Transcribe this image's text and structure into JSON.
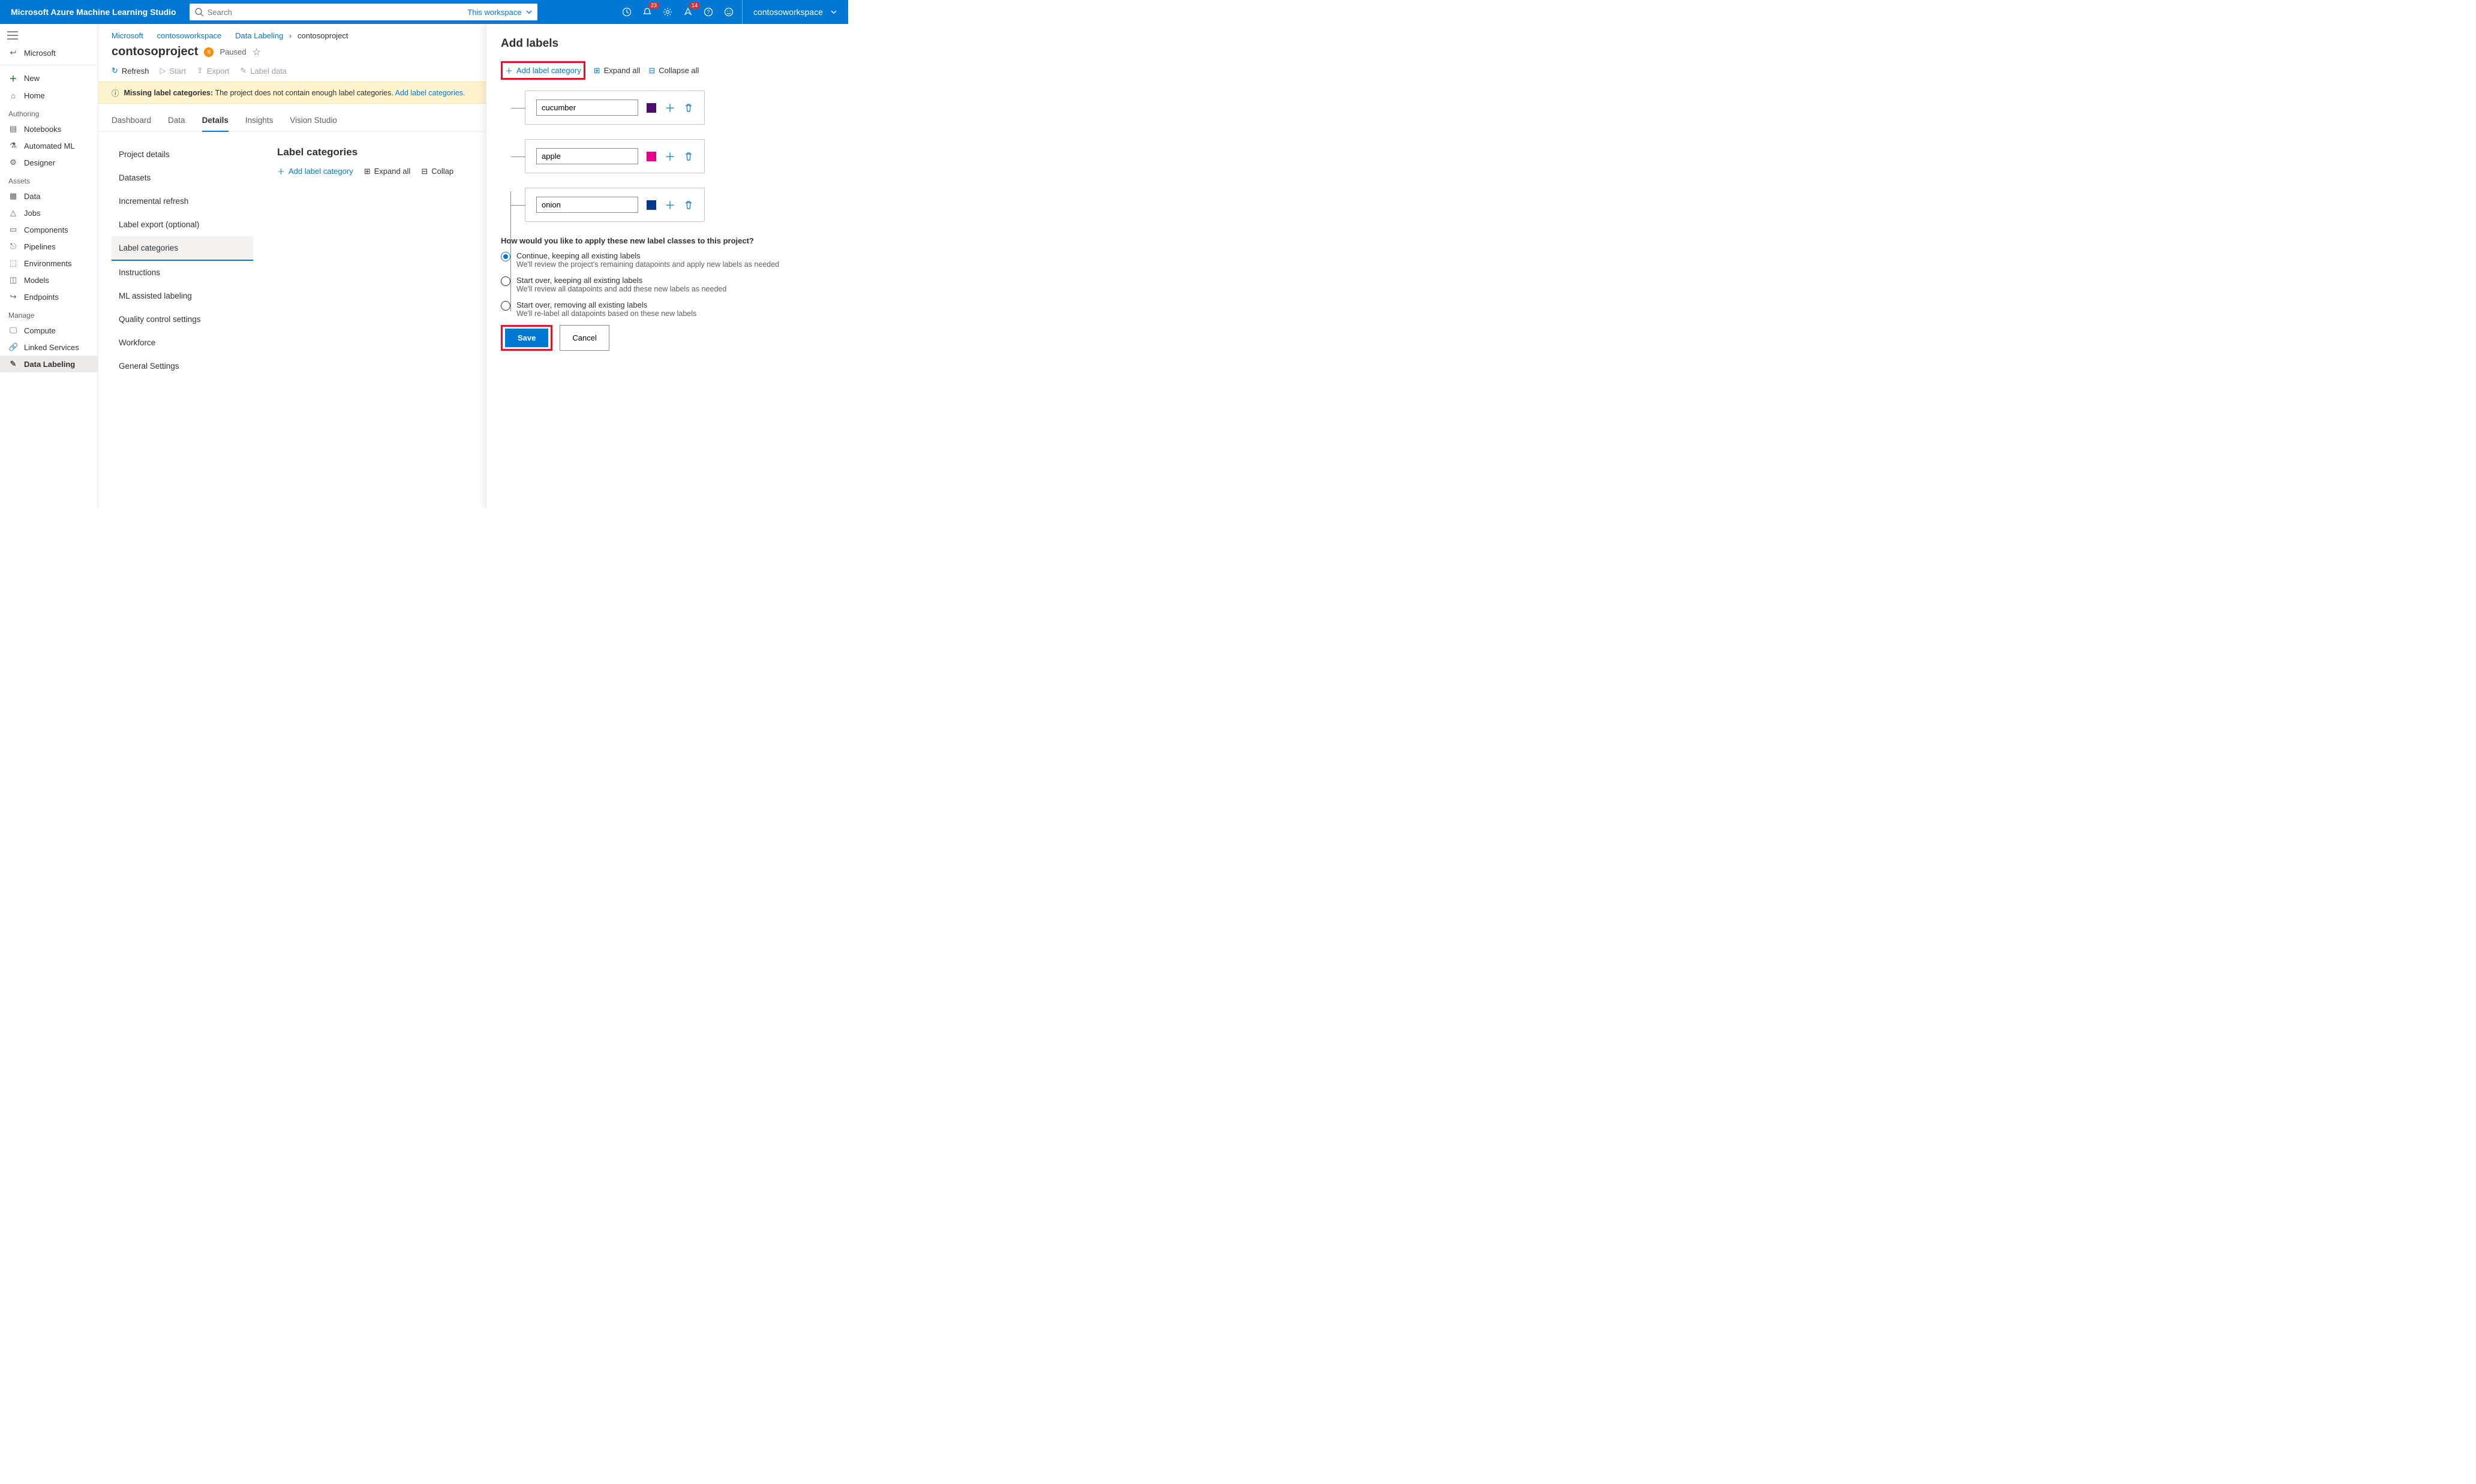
{
  "topbar": {
    "product": "Microsoft Azure Machine Learning Studio",
    "search_placeholder": "Search",
    "scope": "This workspace",
    "bell_badge": "23",
    "arrow_badge": "14",
    "workspace": "contosoworkspace"
  },
  "nav": {
    "back": "Microsoft",
    "items_top": [
      {
        "key": "new",
        "label": "New"
      },
      {
        "key": "home",
        "label": "Home"
      }
    ],
    "section_authoring": "Authoring",
    "items_authoring": [
      {
        "key": "notebooks",
        "label": "Notebooks"
      },
      {
        "key": "automl",
        "label": "Automated ML"
      },
      {
        "key": "designer",
        "label": "Designer"
      }
    ],
    "section_assets": "Assets",
    "items_assets": [
      {
        "key": "data",
        "label": "Data"
      },
      {
        "key": "jobs",
        "label": "Jobs"
      },
      {
        "key": "components",
        "label": "Components"
      },
      {
        "key": "pipelines",
        "label": "Pipelines"
      },
      {
        "key": "environments",
        "label": "Environments"
      },
      {
        "key": "models",
        "label": "Models"
      },
      {
        "key": "endpoints",
        "label": "Endpoints"
      }
    ],
    "section_manage": "Manage",
    "items_manage": [
      {
        "key": "compute",
        "label": "Compute"
      },
      {
        "key": "linked",
        "label": "Linked Services"
      },
      {
        "key": "labeling",
        "label": "Data Labeling"
      }
    ]
  },
  "crumbs": {
    "microsoft": "Microsoft",
    "ws": "contosoworkspace",
    "dl": "Data Labeling",
    "proj": "contosoproject"
  },
  "header": {
    "title": "contosoproject",
    "status": "Paused"
  },
  "toolbar": {
    "refresh": "Refresh",
    "start": "Start",
    "export": "Export",
    "labeldata": "Label data"
  },
  "notice": {
    "lead": "Missing label categories:",
    "body": "The project does not contain enough label categories.",
    "link": "Add label categories."
  },
  "tabs": [
    "Dashboard",
    "Data",
    "Details",
    "Insights",
    "Vision Studio"
  ],
  "active_tab": "Details",
  "subnav": [
    "Project details",
    "Datasets",
    "Incremental refresh",
    "Label export (optional)",
    "Label categories",
    "Instructions",
    "ML assisted labeling",
    "Quality control settings",
    "Workforce",
    "General Settings"
  ],
  "active_subnav": "Label categories",
  "content": {
    "heading": "Label categories",
    "add": "Add label category",
    "expand": "Expand all",
    "collapse": "Collap"
  },
  "panel": {
    "title": "Add labels",
    "add": "Add label category",
    "expand": "Expand all",
    "collapse": "Collapse all",
    "labels": [
      {
        "name": "cucumber",
        "color": "#4b0f6b"
      },
      {
        "name": "apple",
        "color": "#e3008c"
      },
      {
        "name": "onion",
        "color": "#003a8c"
      }
    ],
    "question": "How would you like to apply these new label classes to this project?",
    "options": [
      {
        "t1": "Continue, keeping all existing labels",
        "t2": "We'll review the project's remaining datapoints and apply new labels as needed",
        "selected": true
      },
      {
        "t1": "Start over, keeping all existing labels",
        "t2": "We'll review all datapoints and add these new labels as needed",
        "selected": false
      },
      {
        "t1": "Start over, removing all existing labels",
        "t2": "We'll re-label all datapoints based on these new labels",
        "selected": false
      }
    ],
    "save": "Save",
    "cancel": "Cancel"
  }
}
